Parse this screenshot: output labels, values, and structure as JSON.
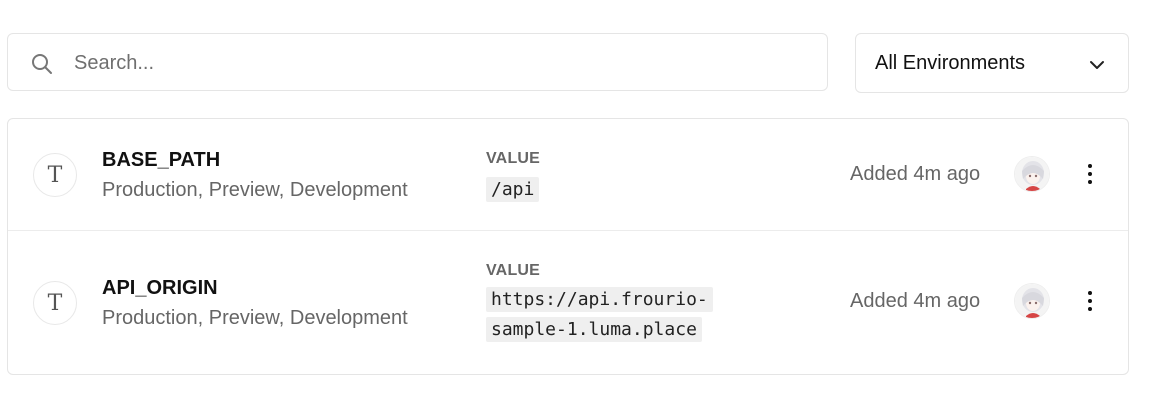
{
  "search": {
    "placeholder": "Search...",
    "icon": "search-icon"
  },
  "environment_filter": {
    "selected": "All Environments",
    "icon": "chevron-down-icon"
  },
  "variables": [
    {
      "type_icon": "T",
      "name": "BASE_PATH",
      "environments": "Production, Preview, Development",
      "value_label": "VALUE",
      "value": "/api",
      "added": "Added 4m ago"
    },
    {
      "type_icon": "T",
      "name": "API_ORIGIN",
      "environments": "Production, Preview, Development",
      "value_label": "VALUE",
      "value": "https://api.frourio-sample-1.luma.place",
      "added": "Added 4m ago"
    }
  ],
  "colors": {
    "border": "#e5e5e5",
    "muted_text": "#666666",
    "code_bg": "#efefef"
  }
}
